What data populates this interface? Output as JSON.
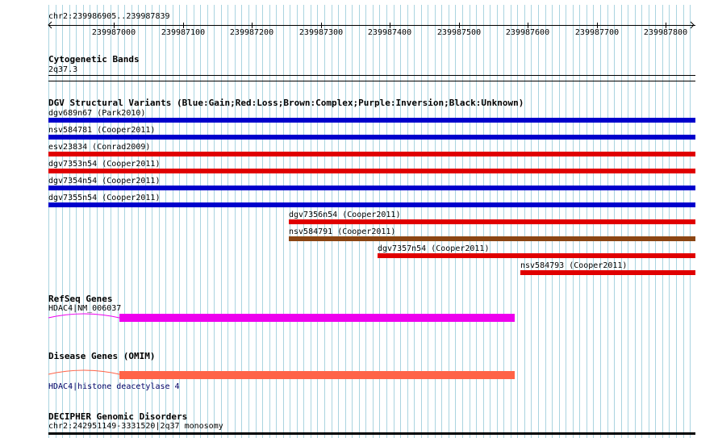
{
  "ruler": {
    "range": "chr2:239986905..239987839",
    "ticks": [
      "239987000",
      "239987100",
      "239987200",
      "239987300",
      "239987400",
      "239987500",
      "239987600",
      "239987700",
      "239987800"
    ]
  },
  "cytoband": {
    "title": "Cytogenetic Bands",
    "band": "2q37.3"
  },
  "dgv": {
    "title": "DGV Structural Variants (Blue:Gain;Red:Loss;Brown:Complex;Purple:Inversion;Black:Unknown)",
    "legend_colors": {
      "gain": "#0000cc",
      "loss": "#e00000",
      "complex": "#8b4513",
      "inversion": "#800080",
      "unknown": "#000000"
    },
    "variants": [
      {
        "label": "dgv689n67 (Park2010)",
        "type": "gain"
      },
      {
        "label": "nsv584781 (Cooper2011)",
        "type": "gain"
      },
      {
        "label": "esv23834 (Conrad2009)",
        "type": "loss"
      },
      {
        "label": "dgv7353n54 (Cooper2011)",
        "type": "loss"
      },
      {
        "label": "dgv7354n54 (Cooper2011)",
        "type": "gain"
      },
      {
        "label": "dgv7355n54 (Cooper2011)",
        "type": "gain"
      },
      {
        "label": "dgv7356n54 (Cooper2011)",
        "type": "loss"
      },
      {
        "label": "nsv584791 (Cooper2011)",
        "type": "complex"
      },
      {
        "label": "dgv7357n54 (Cooper2011)",
        "type": "loss"
      },
      {
        "label": "nsv584793 (Cooper2011)",
        "type": "loss"
      }
    ]
  },
  "refseq": {
    "title": "RefSeq Genes",
    "gene_label": "HDAC4|NM_006037",
    "color": "#ee00ee"
  },
  "disease": {
    "title": "Disease Genes (OMIM)",
    "gene_label": "HDAC4|histone deacetylase 4",
    "color": "#ff6347"
  },
  "decipher": {
    "title": "DECIPHER Genomic Disorders",
    "region_label": "chr2:242951149-3331520|2q37 monosomy"
  }
}
